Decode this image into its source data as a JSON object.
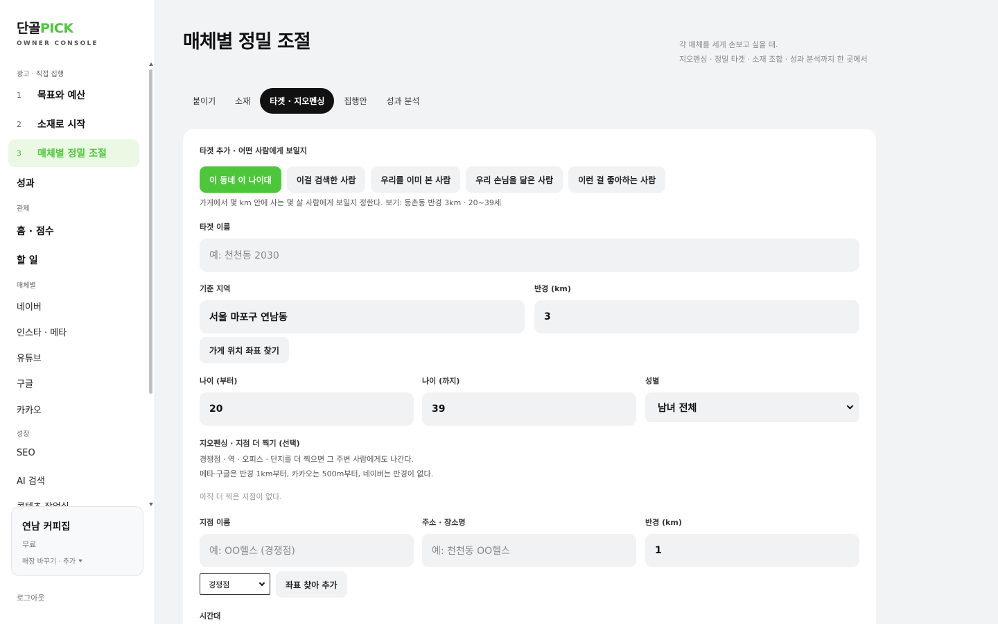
{
  "brand": {
    "name_part1": "단골",
    "name_part2": "PICK",
    "subtitle": "OWNER CONSOLE",
    "accent_color": "#4cc73a"
  },
  "sidebar": {
    "section_ads": "광고 · 직접 집행",
    "steps": [
      {
        "num": "1",
        "label": "목표와 예산"
      },
      {
        "num": "2",
        "label": "소재로 시작"
      },
      {
        "num": "3",
        "label": "매체별 정밀 조절",
        "active": true
      }
    ],
    "performance": "성과",
    "section_control": "관제",
    "home_score": "홈 · 점수",
    "todo": "할 일",
    "section_media": "매체별",
    "media": [
      "네이버",
      "인스타 · 메타",
      "유튜브",
      "구글",
      "카카오"
    ],
    "section_growth": "성장",
    "growth": [
      "SEO",
      "AI 검색",
      "콘텐츠 작업실"
    ],
    "store": {
      "name": "연남 커피집",
      "plan": "무료",
      "switch_label": "매장 바꾸기 · 추가"
    },
    "logout": "로그아웃"
  },
  "header": {
    "title": "매체별 정밀 조절",
    "desc_line1": "각 매체를 세게 손보고 싶을 때.",
    "desc_line2": "지오펜싱 · 정밀 타겟 · 소재 조합 · 성과 분석까지 한 곳에서"
  },
  "tabs": [
    {
      "label": "붙이기"
    },
    {
      "label": "소재"
    },
    {
      "label": "타겟 · 지오펜싱",
      "active": true
    },
    {
      "label": "집행안"
    },
    {
      "label": "성과 분석"
    }
  ],
  "form": {
    "target_add_label": "타겟 추가 · 어떤 사람에게 보일지",
    "chips": [
      "이 동네 이 나이대",
      "이걸 검색한 사람",
      "우리를 이미 본 사람",
      "우리 손님을 닮은 사람",
      "이런 걸 좋아하는 사람"
    ],
    "chip_hint": "가게에서 몇 km 안에 사는 몇 살 사람에게 보일지 정한다. 보기: 등촌동 반경 3km · 20~39세",
    "target_name_label": "타겟 이름",
    "target_name_placeholder": "예: 천천동 2030",
    "region_label": "기준 지역",
    "region_value": "서울 마포구 연남동",
    "radius_label": "반경 (km)",
    "radius_value": "3",
    "find_coords_button": "가게 위치 좌표 찾기",
    "age_from_label": "나이 (부터)",
    "age_from_value": "20",
    "age_to_label": "나이 (까지)",
    "age_to_value": "39",
    "gender_label": "성별",
    "gender_value": "남녀 전체",
    "geofence_label": "지오펜싱 · 지점 더 찍기 (선택)",
    "geofence_hint1": "경쟁점 · 역 · 오피스 · 단지를 더 찍으면 그 주변 사람에게도 나간다.",
    "geofence_hint2": "메타·구글은 반경 1km부터, 카카오는 500m부터, 네이버는 반경이 없다.",
    "geofence_empty": "아직 더 찍은 지점이 없다.",
    "point_name_label": "지점 이름",
    "point_name_placeholder": "예: OO헬스 (경쟁점)",
    "address_label": "주소 · 장소명",
    "address_placeholder": "예: 천천동 OO헬스",
    "point_radius_label": "반경 (km)",
    "point_radius_value": "1",
    "point_type_value": "경쟁점",
    "add_point_button": "좌표 찾아 추가",
    "time_label": "시간대"
  }
}
